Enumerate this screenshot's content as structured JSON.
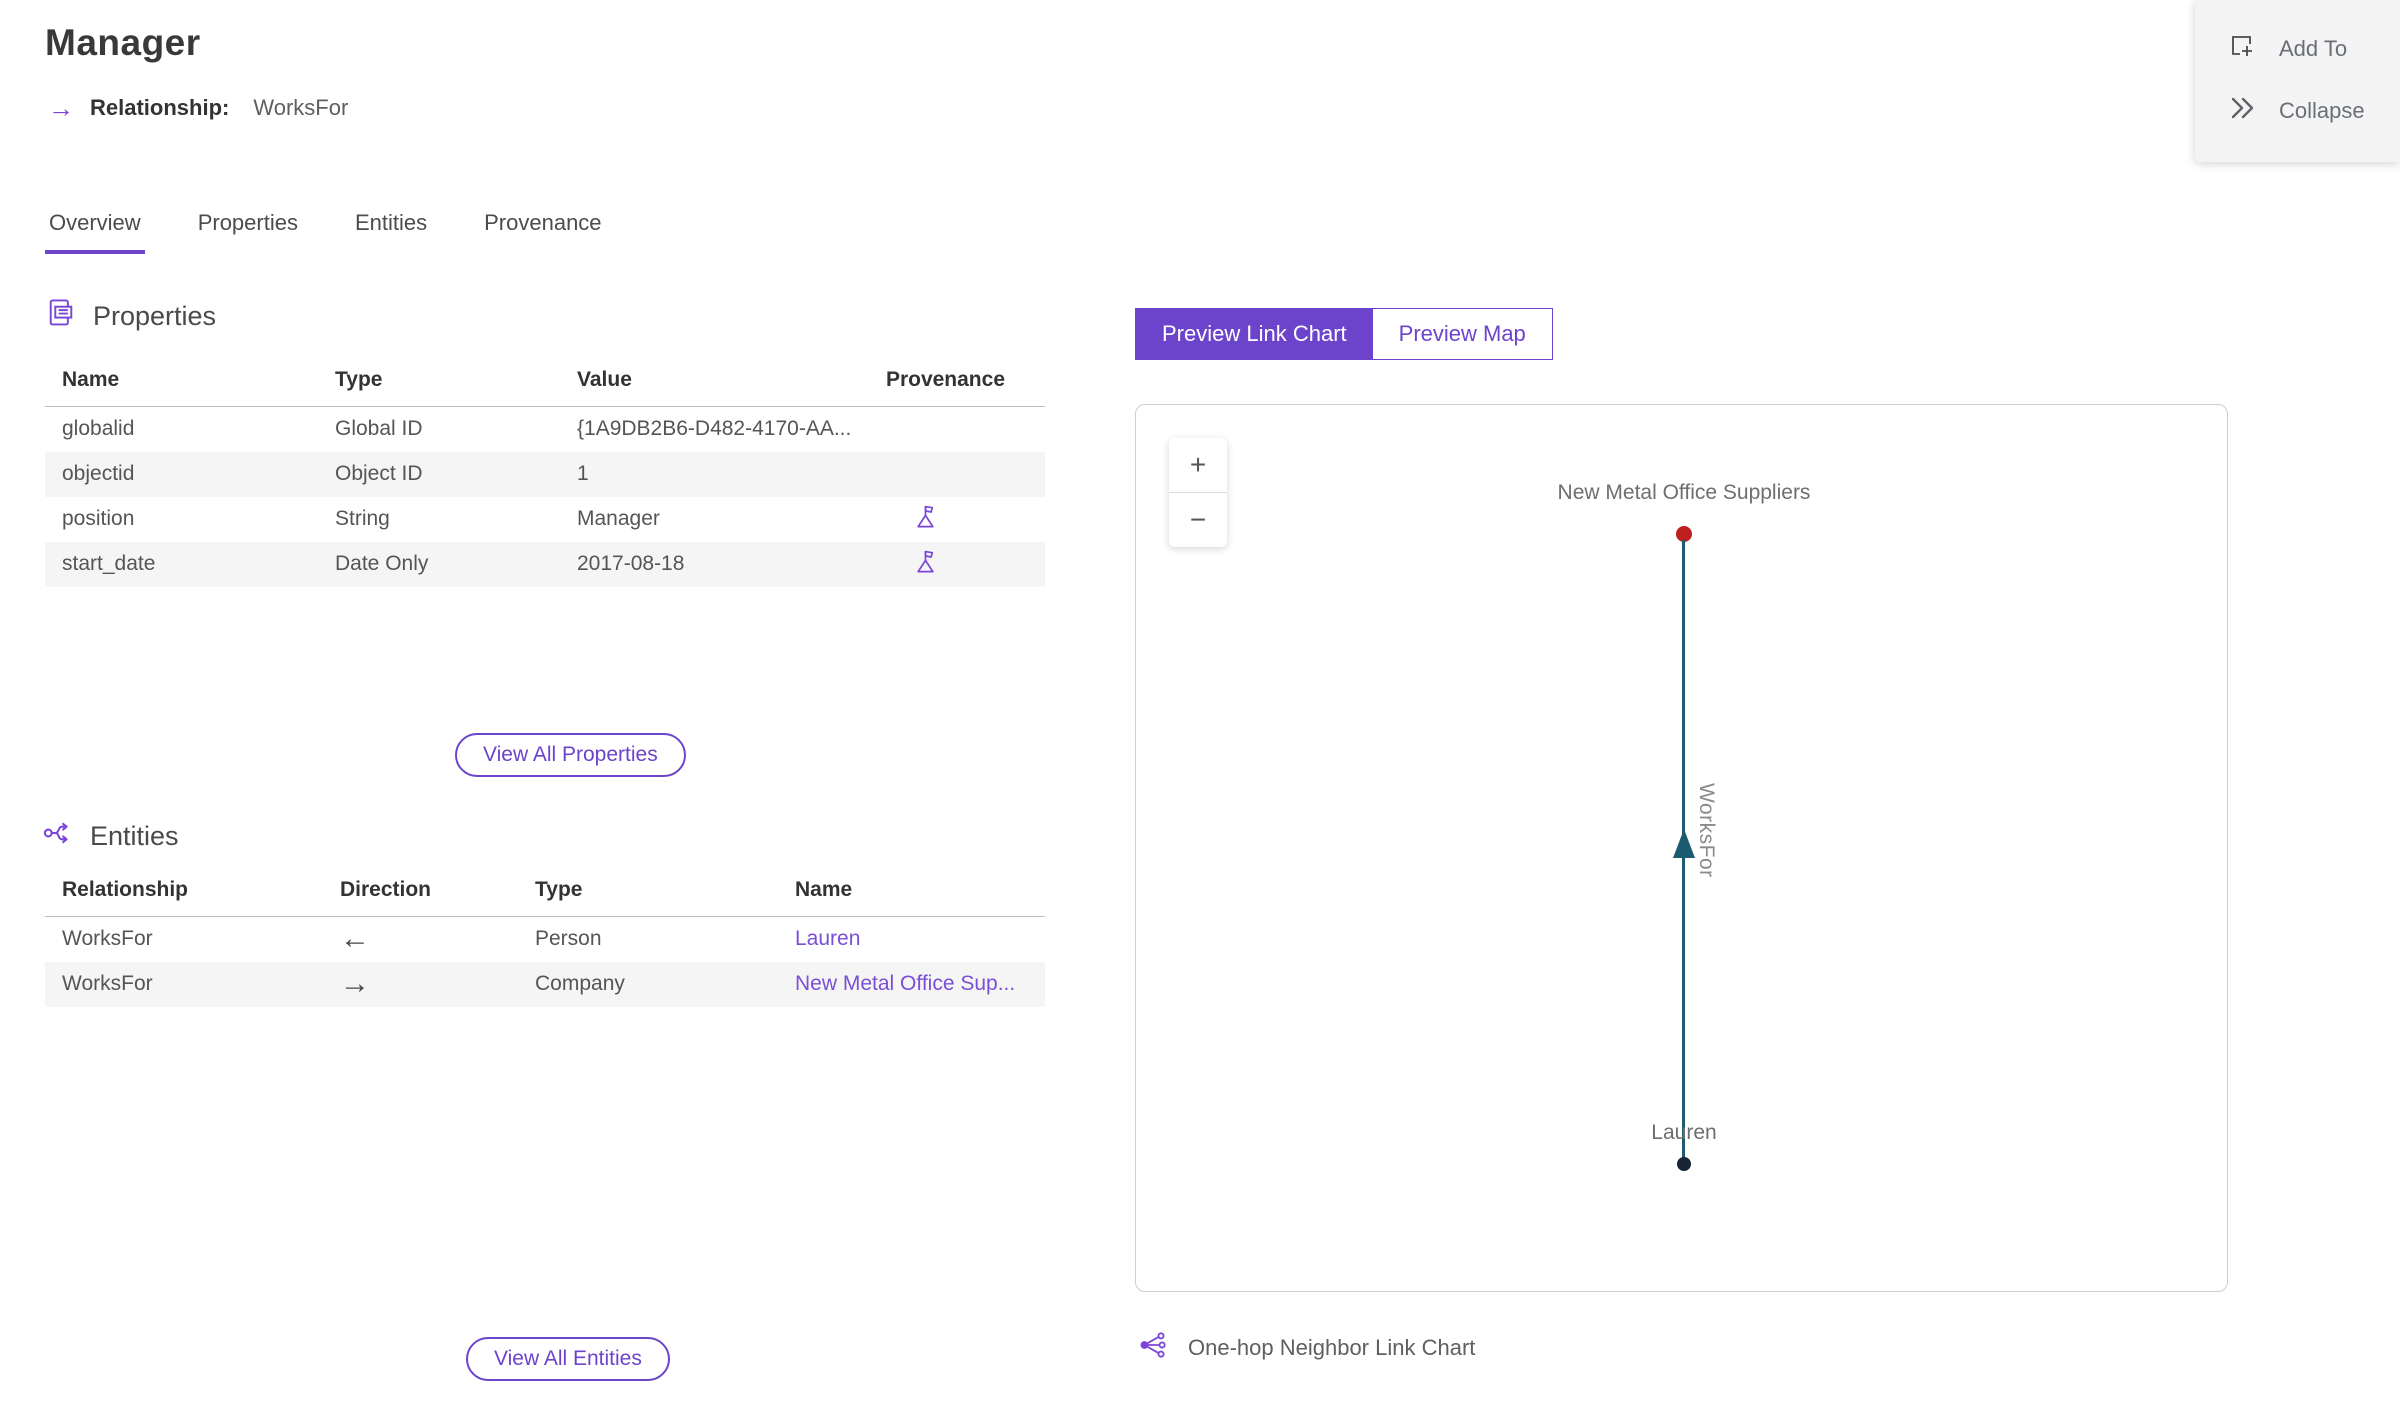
{
  "accent_color": "#6c44cc",
  "header": {
    "title": "Manager",
    "relationship_label": "Relationship:",
    "relationship_value": "WorksFor",
    "arrow_icon": "→"
  },
  "actions": {
    "add_to": "Add To",
    "collapse": "Collapse"
  },
  "tabs": [
    {
      "label": "Overview",
      "active": true
    },
    {
      "label": "Properties",
      "active": false
    },
    {
      "label": "Entities",
      "active": false
    },
    {
      "label": "Provenance",
      "active": false
    }
  ],
  "properties_section": {
    "title": "Properties",
    "columns": {
      "name": "Name",
      "type": "Type",
      "value": "Value",
      "provenance": "Provenance"
    },
    "rows": [
      {
        "name": "globalid",
        "type": "Global ID",
        "value": "{1A9DB2B6-D482-4170-AA...",
        "has_provenance": false
      },
      {
        "name": "objectid",
        "type": "Object ID",
        "value": "1",
        "has_provenance": false
      },
      {
        "name": "position",
        "type": "String",
        "value": "Manager",
        "has_provenance": true
      },
      {
        "name": "start_date",
        "type": "Date Only",
        "value": "2017-08-18",
        "has_provenance": true
      }
    ],
    "view_all_label": "View All Properties"
  },
  "entities_section": {
    "title": "Entities",
    "columns": {
      "relationship": "Relationship",
      "direction": "Direction",
      "type": "Type",
      "name": "Name"
    },
    "rows": [
      {
        "relationship": "WorksFor",
        "direction": "←",
        "type": "Person",
        "name": "Lauren"
      },
      {
        "relationship": "WorksFor",
        "direction": "→",
        "type": "Company",
        "name": "New Metal Office Sup..."
      }
    ],
    "view_all_label": "View All Entities"
  },
  "preview": {
    "tabs": [
      {
        "label": "Preview Link Chart",
        "active": true
      },
      {
        "label": "Preview Map",
        "active": false
      }
    ],
    "zoom_in": "+",
    "zoom_out": "−",
    "caption": "One-hop Neighbor Link Chart"
  },
  "link_chart": {
    "type": "link-chart",
    "nodes": [
      {
        "label": "New Metal Office Suppliers",
        "color": "#c01f1f",
        "position": "top"
      },
      {
        "label": "Lauren",
        "color": "#182435",
        "position": "bottom"
      }
    ],
    "edge": {
      "label": "WorksFor",
      "from": "Lauren",
      "to": "New Metal Office Suppliers",
      "color": "#1d5b70",
      "direction": "up"
    }
  }
}
